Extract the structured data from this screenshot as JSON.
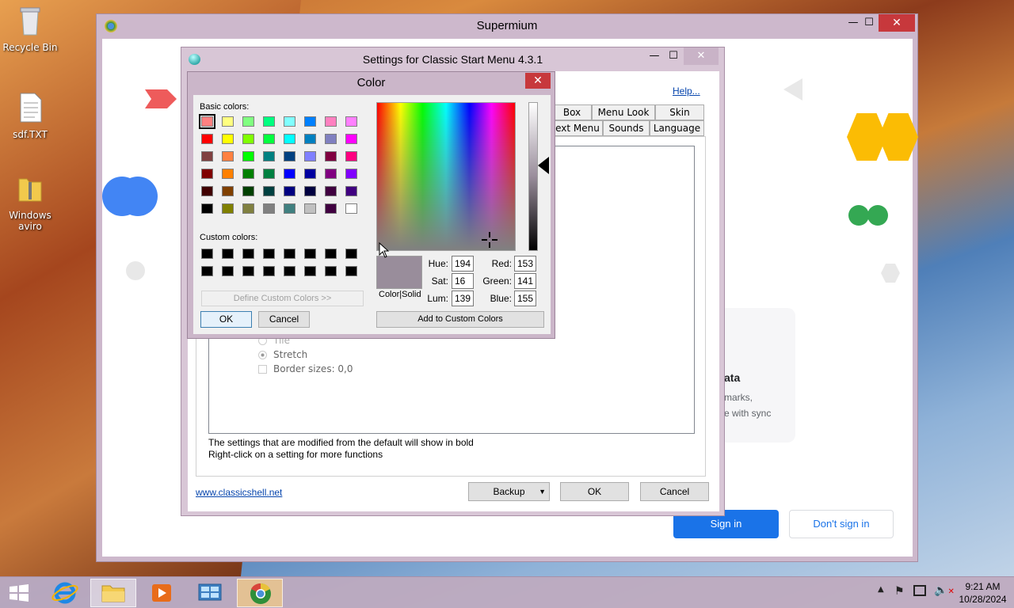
{
  "desktop": {
    "icons": [
      {
        "label": "Recycle Bin",
        "icon": "recycle-bin-icon"
      },
      {
        "label": "sdf.TXT",
        "icon": "text-file-icon"
      },
      {
        "label": "Windows aviro",
        "icon": "zip-folder-icon"
      }
    ]
  },
  "supermium": {
    "title": "Supermium",
    "page": {
      "heading_fragment": "ata",
      "line1_fragment": "marks,",
      "line2_fragment": "e with sync",
      "sign_in_label": "Sign in",
      "dont_sign_in_label": "Don't sign in",
      "accent_color": "#1a73e8"
    }
  },
  "settings": {
    "title": "Settings for Classic Start Menu 4.3.1",
    "help_link": "Help...",
    "tabs_row1": [
      "Box",
      "Menu Look",
      "Skin"
    ],
    "tabs_row2": [
      "ext Menu",
      "Sounds",
      "Language"
    ],
    "options": [
      {
        "label": "Tile",
        "type": "radio",
        "checked": false
      },
      {
        "label": "Stretch",
        "type": "radio",
        "checked": true
      },
      {
        "label": "Border sizes: 0,0",
        "type": "checkbox",
        "checked": false
      }
    ],
    "note1": "The settings that are modified from the default will show in bold",
    "note2": "Right-click on a setting for more functions",
    "website_link": "www.classicshell.net",
    "backup_label": "Backup",
    "ok_label": "OK",
    "cancel_label": "Cancel"
  },
  "color_dialog": {
    "title": "Color",
    "basic_colors_label": "Basic colors:",
    "custom_colors_label": "Custom colors:",
    "define_custom_label": "Define Custom Colors >>",
    "ok_label": "OK",
    "cancel_label": "Cancel",
    "add_custom_label": "Add to Custom Colors",
    "color_solid_label": "Color|Solid",
    "basic_colors": [
      "#ff8080",
      "#ffff80",
      "#80ff80",
      "#00ff80",
      "#80ffff",
      "#0080ff",
      "#ff80c0",
      "#ff80ff",
      "#ff0000",
      "#ffff00",
      "#80ff00",
      "#00ff40",
      "#00ffff",
      "#0080c0",
      "#8080c0",
      "#ff00ff",
      "#804040",
      "#ff8040",
      "#00ff00",
      "#008080",
      "#004080",
      "#8080ff",
      "#800040",
      "#ff0080",
      "#800000",
      "#ff8000",
      "#008000",
      "#008040",
      "#0000ff",
      "#0000a0",
      "#800080",
      "#8000ff",
      "#400000",
      "#804000",
      "#004000",
      "#004040",
      "#000080",
      "#000040",
      "#400040",
      "#400080",
      "#000000",
      "#808000",
      "#808040",
      "#808080",
      "#408080",
      "#c0c0c0",
      "#400040",
      "#ffffff"
    ],
    "custom_colors": [
      "#000000",
      "#000000",
      "#000000",
      "#000000",
      "#000000",
      "#000000",
      "#000000",
      "#000000",
      "#000000",
      "#000000",
      "#000000",
      "#000000",
      "#000000",
      "#000000",
      "#000000",
      "#000000"
    ],
    "selected_color": "#998d9b",
    "fields": {
      "hue_label": "Hue:",
      "hue": "194",
      "sat_label": "Sat:",
      "sat": "16",
      "lum_label": "Lum:",
      "lum": "139",
      "red_label": "Red:",
      "red": "153",
      "green_label": "Green:",
      "green": "141",
      "blue_label": "Blue:",
      "blue": "155"
    }
  },
  "taskbar": {
    "time": "9:21 AM",
    "date": "10/28/2024",
    "pinned": [
      "start-icon",
      "internet-explorer-icon",
      "file-explorer-icon",
      "media-player-icon",
      "control-panel-icon",
      "supermium-icon"
    ]
  }
}
